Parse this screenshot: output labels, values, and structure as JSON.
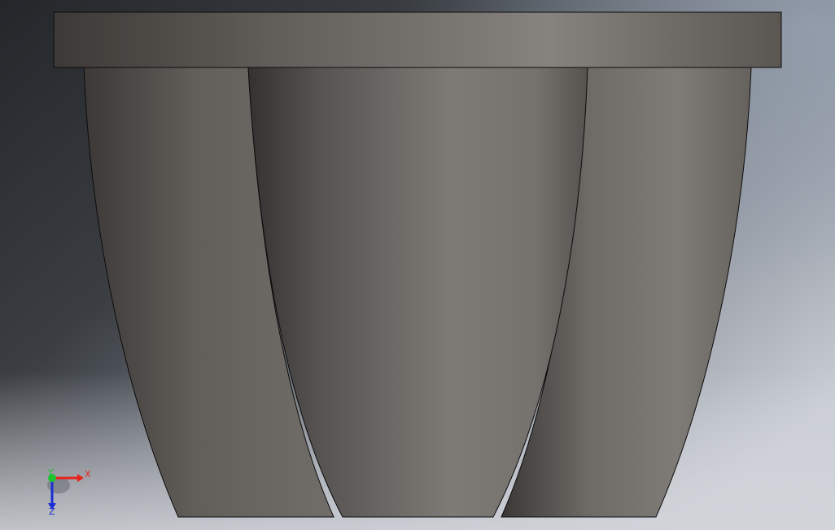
{
  "viewport": {
    "background_dark": "#26292c",
    "background_mid": "#5f646a",
    "background_light": "#c4c8d0",
    "model_edge_color": "#0c0c0c"
  },
  "model": {
    "name": "cad-part",
    "color_shadow": "#3a3836",
    "color_highlight": "#86827e"
  },
  "triad": {
    "x_label": "X",
    "y_label": "Y",
    "z_label": "Z",
    "x_color": "#e8231c",
    "y_color": "#1fc430",
    "z_color": "#1a2fd6"
  }
}
